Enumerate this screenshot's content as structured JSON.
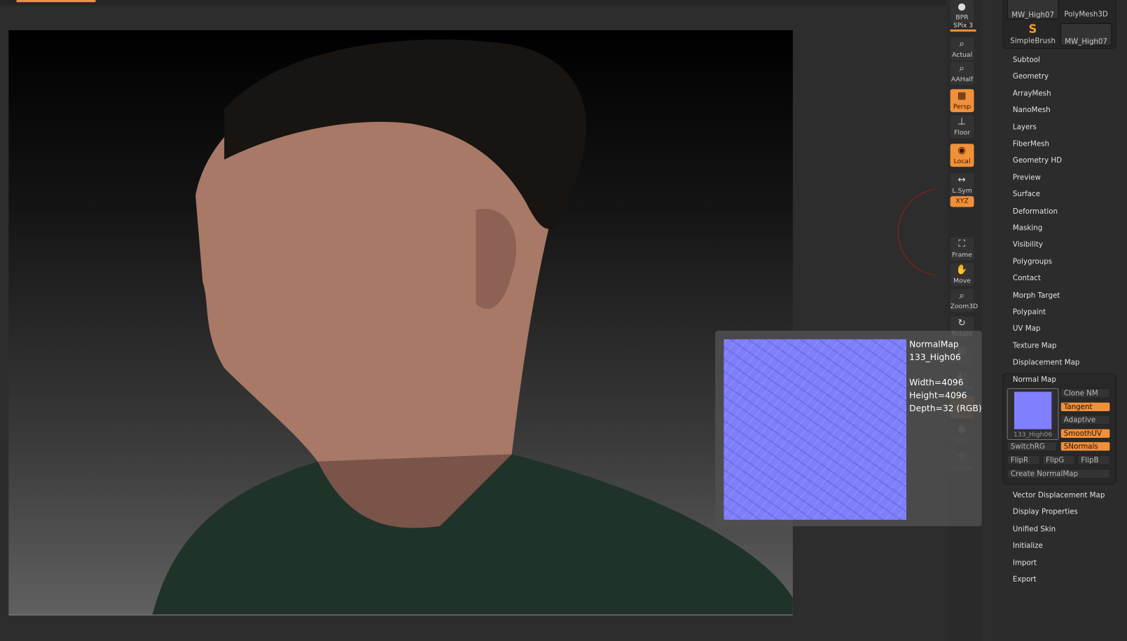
{
  "toolbar": {
    "items": [
      {
        "label": "BPR",
        "icon": "sphere-icon",
        "on": false
      },
      {
        "label": "Actual",
        "icon": "zoom-actual-icon",
        "on": false
      },
      {
        "label": "AAHalf",
        "icon": "zoom-aahalf-icon",
        "on": false
      },
      {
        "label": "Persp",
        "icon": "perspective-grid-icon",
        "on": true
      },
      {
        "label": "Floor",
        "icon": "floor-icon",
        "on": false
      },
      {
        "label": "Local",
        "icon": "local-icon",
        "on": true
      },
      {
        "label": "L.Sym",
        "icon": "symmetry-icon",
        "on": false
      },
      {
        "label": "Frame",
        "icon": "frame-icon",
        "on": false
      },
      {
        "label": "Move",
        "icon": "hand-icon",
        "on": false
      },
      {
        "label": "Zoom3D",
        "icon": "zoom3d-icon",
        "on": false
      },
      {
        "label": "Rotate",
        "icon": "rotate-icon",
        "on": false
      },
      {
        "label": "PolyF",
        "icon": "polyframe-icon",
        "on": false
      },
      {
        "label": "Transp",
        "icon": "transparency-icon",
        "on": false
      },
      {
        "label": "Ghost",
        "icon": "ghost-icon",
        "on": true
      },
      {
        "label": "Solo",
        "icon": "solo-icon",
        "on": false
      },
      {
        "label": "Xpose",
        "icon": "xpose-icon",
        "on": false
      }
    ],
    "spix": "SPix 3",
    "xyz": "XYZ"
  },
  "tools": [
    "MW_High07",
    "PolyMesh3D",
    "SimpleBrush",
    "MW_High07"
  ],
  "menu": [
    "Subtool",
    "Geometry",
    "ArrayMesh",
    "NanoMesh",
    "Layers",
    "FiberMesh",
    "Geometry HD",
    "Preview",
    "Surface",
    "Deformation",
    "Masking",
    "Visibility",
    "Polygroups",
    "Contact",
    "Morph Target",
    "Polypaint",
    "UV Map",
    "Texture Map",
    "Displacement Map"
  ],
  "normal_map": {
    "title": "Normal Map",
    "thumb_label": "133_High06",
    "clone": "Clone NM",
    "tangent": "Tangent",
    "adaptive": "Adaptive",
    "smoothuv": "SmoothUV",
    "switchrg": "SwitchRG",
    "snormals": "SNormals",
    "flipr": "FlipR",
    "flipg": "FlipG",
    "flipb": "FlipB",
    "create": "Create NormalMap"
  },
  "menu_after": [
    "Vector Displacement Map",
    "Display Properties",
    "Unified Skin",
    "Initialize",
    "Import",
    "Export"
  ],
  "popup": {
    "name": "NormalMap",
    "file": "133_High06",
    "width": "Width=4096",
    "height": "Height=4096",
    "depth": "Depth=32 (RGB)"
  },
  "colors": {
    "accent": "#f0903a",
    "normal_map": "#8080ff"
  }
}
